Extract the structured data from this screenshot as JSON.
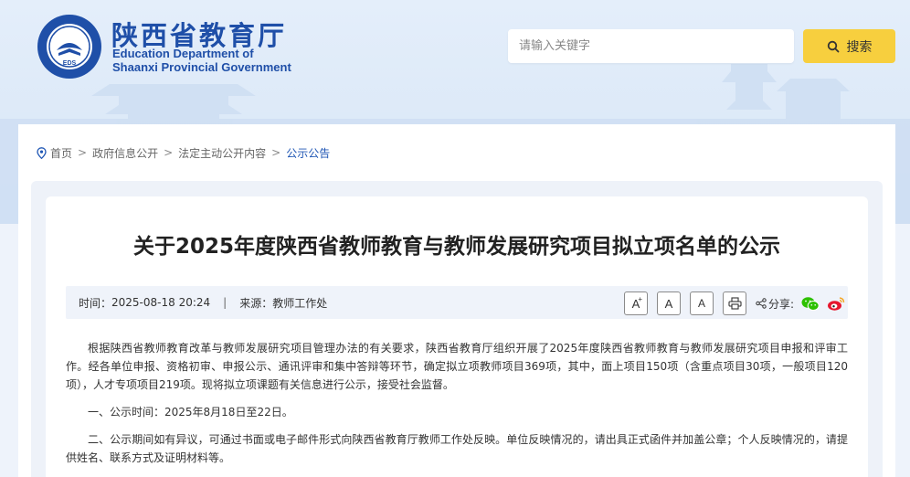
{
  "header": {
    "title_cn": "陕西省教育厅",
    "title_en_line1": "Education Department of",
    "title_en_line2": "Shaanxi Provincial Government",
    "emblem_text": "EDS"
  },
  "search": {
    "placeholder": "请输入关键字",
    "button_label": "搜索"
  },
  "breadcrumb": {
    "items": [
      "首页",
      "政府信息公开",
      "法定主动公开内容",
      "公示公告"
    ],
    "separator": ">"
  },
  "article": {
    "title": "关于2025年度陕西省教师教育与教师发展研究项目拟立项名单的公示",
    "time_label": "时间：",
    "time_value": "2025-08-18 20:24",
    "meta_divider": "|",
    "source_label": "来源：",
    "source_value": "教师工作处",
    "share_label": "分享:",
    "tools": {
      "font_large": "A",
      "font_large_sup": "+",
      "font_medium": "A",
      "font_small": "A"
    },
    "paragraphs": [
      "根据陕西省教师教育改革与教师发展研究项目管理办法的有关要求，陕西省教育厅组织开展了2025年度陕西省教师教育与教师发展研究项目申报和评审工作。经各单位申报、资格初审、申报公示、通讯评审和集中答辩等环节，确定拟立项教师项目369项，其中，面上项目150项（含重点项目30项，一般项目120项），人才专项项目219项。现将拟立项课题有关信息进行公示，接受社会监督。",
      "一、公示时间：2025年8月18日至22日。",
      "二、公示期间如有异议，可通过书面或电子邮件形式向陕西省教育厅教师工作处反映。单位反映情况的，请出具正式函件并加盖公章；个人反映情况的，请提供姓名、联系方式及证明材料等。"
    ]
  },
  "colors": {
    "brand_blue": "#1f4fa8",
    "search_yellow": "#f7cf3e",
    "link_active": "#1f56b4",
    "wechat_green": "#2dc100",
    "weibo_red": "#e6162d"
  }
}
